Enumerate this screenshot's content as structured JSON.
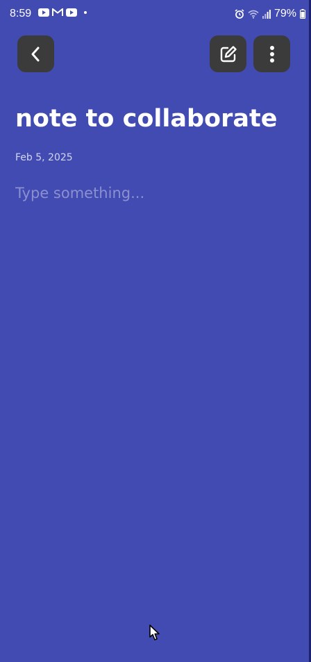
{
  "status_bar": {
    "time": "8:59",
    "battery": "79%",
    "left_icons": [
      "youtube-icon",
      "gmail-icon",
      "youtube-icon",
      "notification-dot"
    ],
    "right_icons": [
      "alarm-icon",
      "wifi-icon",
      "signal-icon",
      "battery-icon"
    ]
  },
  "toolbar": {
    "back_icon": "chevron-left-icon",
    "edit_icon": "edit-icon",
    "more_icon": "more-vertical-icon"
  },
  "note": {
    "title": "note to collaborate",
    "date": "Feb 5, 2025",
    "body_value": "",
    "body_placeholder": "Type something..."
  },
  "colors": {
    "background": "#424bb1",
    "button_bg": "#3b3b3b",
    "text": "#ffffff",
    "date_text": "#d3d6f1",
    "placeholder_text": "#8a90d0"
  }
}
